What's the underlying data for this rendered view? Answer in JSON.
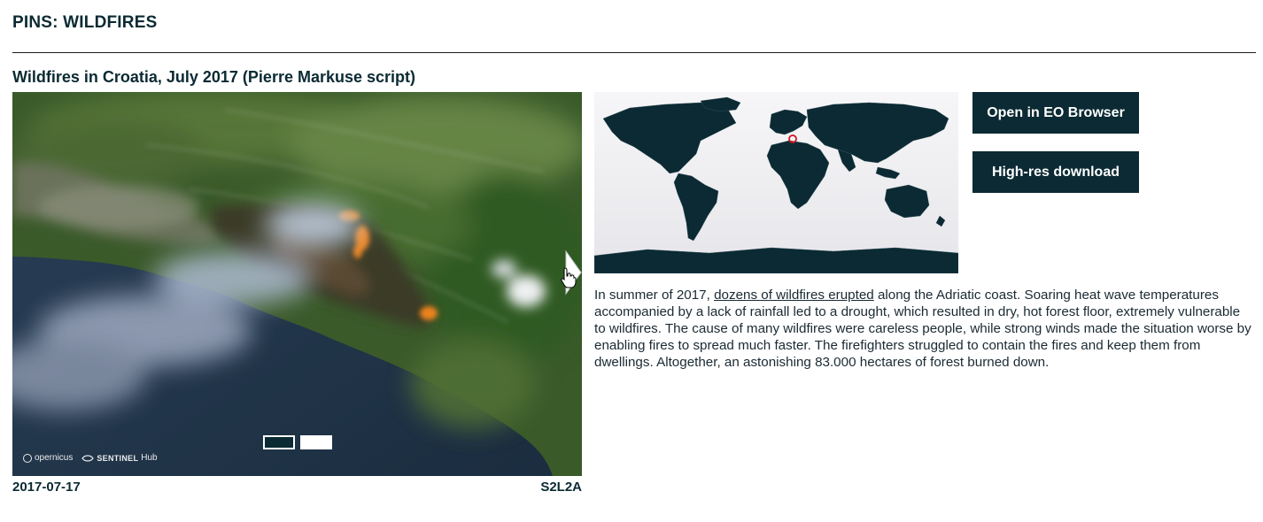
{
  "header": {
    "title": "PINS: WILDFIRES"
  },
  "pin": {
    "title": "Wildfires in Croatia, July 2017 (Pierre Markuse script)",
    "date": "2017-07-17",
    "sensor": "S2L2A",
    "pager": {
      "current": 1,
      "total": 2
    },
    "logo": {
      "copernicus": "opernicus",
      "sentinel": "SENTINEL",
      "hub": "Hub"
    }
  },
  "actions": {
    "open_eo_browser": "Open in EO Browser",
    "high_res_download": "High-res download"
  },
  "description": {
    "before": "In summer of 2017, ",
    "link": "dozens of wildfires erupted",
    "after": " along the Adriatic coast. Soaring heat wave temperatures accompanied by a lack of rainfall led to a drought, which resulted in dry, hot forest floor, extremely vulnerable to wildfires. The cause of many wildfires were careless people, while strong winds made the situation worse by enabling fires to spread much faster. The firefighters struggled to contain the fires and keep them from dwellings. Altogether, an astonishing 83.000 hectares of forest burned down."
  },
  "colors": {
    "brand_dark": "#0b2a33",
    "marker": "#d0121b",
    "map_background": "#f2f2f4"
  }
}
